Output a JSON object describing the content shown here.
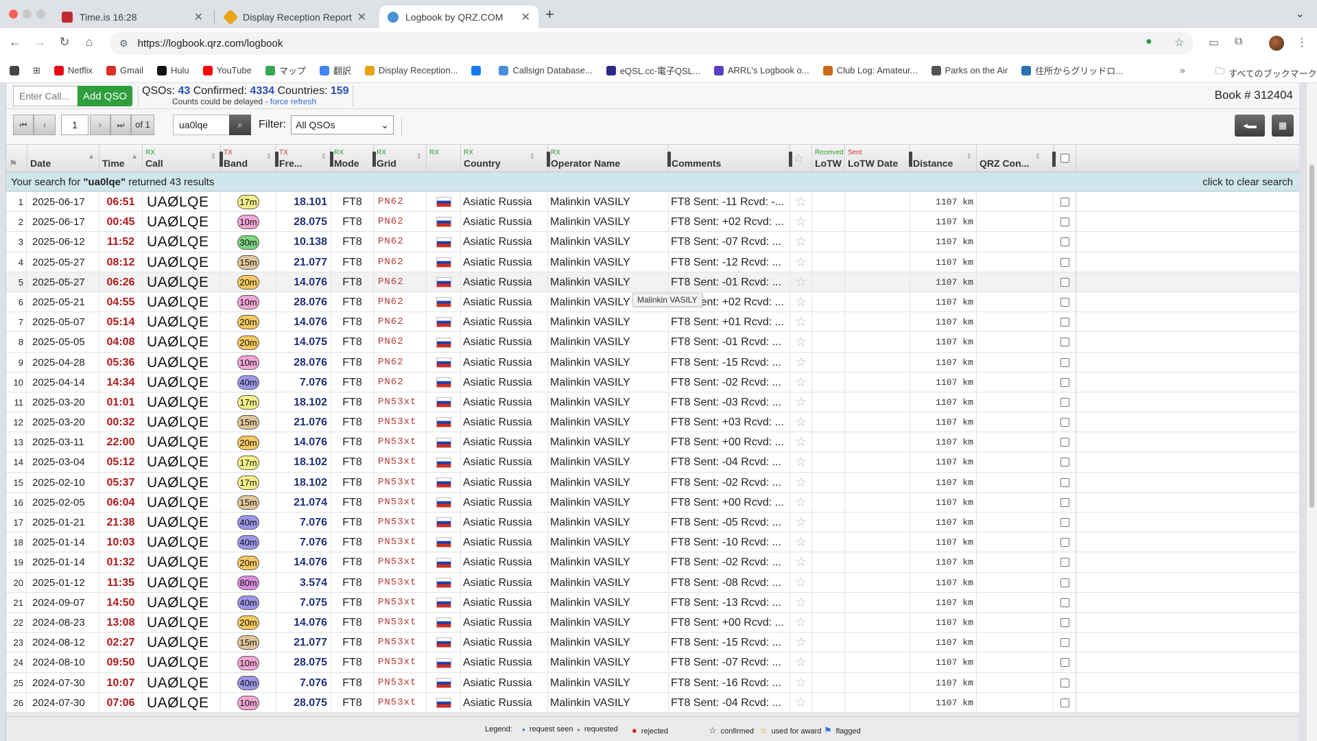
{
  "browser": {
    "tabs": [
      {
        "title": "Time.is 16:28",
        "favicon_color": "#c0282d",
        "active": false
      },
      {
        "title": "Display Reception Reports",
        "favicon_color": "#e8a317",
        "active": false
      },
      {
        "title": "Logbook by QRZ.COM",
        "favicon_color": "#4a90d9",
        "active": true
      }
    ],
    "url": "https://logbook.qrz.com/logbook",
    "bookmarks": [
      {
        "label": "Netflix",
        "color": "#e50914"
      },
      {
        "label": "Gmail",
        "color": "#d93025"
      },
      {
        "label": "Hulu",
        "color": "#111111"
      },
      {
        "label": "YouTube",
        "color": "#ff0000"
      },
      {
        "label": "マップ",
        "color": "#34a853"
      },
      {
        "label": "翻訳",
        "color": "#4285f4"
      },
      {
        "label": "Display Reception...",
        "color": "#e8a317"
      },
      {
        "label": "",
        "color": "#1877f2"
      },
      {
        "label": "Callsign Database...",
        "color": "#4a90d9"
      },
      {
        "label": "eQSL.cc-電子QSL...",
        "color": "#2b2b8a"
      },
      {
        "label": "ARRL's Logbook o...",
        "color": "#5a3fc0"
      },
      {
        "label": "Club Log: Amateur...",
        "color": "#c96a1a"
      },
      {
        "label": "Parks on the Air",
        "color": "#555555"
      },
      {
        "label": "住所からグリッドロ...",
        "color": "#2a6fb0"
      }
    ],
    "all_bookmarks": "すべてのブックマーク"
  },
  "header": {
    "call_placeholder": "Enter Call...",
    "add_qso": "Add QSO",
    "qsos_label": "QSOs:",
    "qsos": "43",
    "confirmed_label": "Confirmed:",
    "confirmed": "4334",
    "countries_label": "Countries:",
    "countries": "159",
    "delay_note": "Counts could be delayed - ",
    "force_refresh": "force refresh",
    "book": "Book # 312404"
  },
  "pager": {
    "page": "1",
    "of": "of 1",
    "search_value": "ua0lqe",
    "filter_label": "Filter:",
    "filter_value": "All QSOs"
  },
  "columns": {
    "date": "Date",
    "time": "Time",
    "call_sub": "RX",
    "call": "Call",
    "band_sub": "TX",
    "band": "Band",
    "freq_sub": "TX",
    "freq": "Fre...",
    "mode_sub": "RX",
    "mode": "Mode",
    "grid_sub": "RX",
    "grid": "Grid",
    "flag_sub": "RX",
    "country_sub": "RX",
    "country": "Country",
    "op_sub": "RX",
    "op": "Operator Name",
    "comments": "Comments",
    "lotw_sub": "Received",
    "lotw": "LoTW",
    "lotwd_sub": "Sent",
    "lotwd": "LoTW Date",
    "distance": "Distance",
    "qrz": "QRZ Con..."
  },
  "banner": {
    "prefix": "Your search for ",
    "term": "\"ua0lqe\"",
    "suffix": " returned 43 results",
    "clear": "click to clear search"
  },
  "band_colors": {
    "17m": "#f4ef8a",
    "10m": "#f2a6d6",
    "30m": "#7fd67f",
    "15m": "#e0c69a",
    "20m": "#f6c861",
    "40m": "#9d96e8",
    "80m": "#d88fe0"
  },
  "rows": [
    {
      "n": "1",
      "date": "2025-06-17",
      "time": "06:51",
      "call": "UAØLQE",
      "band": "17m",
      "freq": "18.101",
      "mode": "FT8",
      "grid": "PN62",
      "country": "Asiatic Russia",
      "op": "Malinkin VASILY",
      "comment": "FT8 Sent: -11 Rcvd: -...",
      "dist": "1107",
      "unit": "km"
    },
    {
      "n": "2",
      "date": "2025-06-17",
      "time": "00:45",
      "call": "UAØLQE",
      "band": "10m",
      "freq": "28.075",
      "mode": "FT8",
      "grid": "PN62",
      "country": "Asiatic Russia",
      "op": "Malinkin VASILY",
      "comment": "FT8 Sent: +02 Rcvd: ...",
      "dist": "1107",
      "unit": "km"
    },
    {
      "n": "3",
      "date": "2025-06-12",
      "time": "11:52",
      "call": "UAØLQE",
      "band": "30m",
      "freq": "10.138",
      "mode": "FT8",
      "grid": "PN62",
      "country": "Asiatic Russia",
      "op": "Malinkin VASILY",
      "comment": "FT8 Sent: -07 Rcvd: ...",
      "dist": "1107",
      "unit": "km"
    },
    {
      "n": "4",
      "date": "2025-05-27",
      "time": "08:12",
      "call": "UAØLQE",
      "band": "15m",
      "freq": "21.077",
      "mode": "FT8",
      "grid": "PN62",
      "country": "Asiatic Russia",
      "op": "Malinkin VASILY",
      "comment": "FT8 Sent: -12 Rcvd: ...",
      "dist": "1107",
      "unit": "km"
    },
    {
      "n": "5",
      "date": "2025-05-27",
      "time": "06:26",
      "call": "UAØLQE",
      "band": "20m",
      "freq": "14.076",
      "mode": "FT8",
      "grid": "PN62",
      "country": "Asiatic Russia",
      "op": "Malinkin VASILY",
      "comment": "FT8 Sent: -01 Rcvd: ...",
      "dist": "1107",
      "unit": "km"
    },
    {
      "n": "6",
      "date": "2025-05-21",
      "time": "04:55",
      "call": "UAØLQE",
      "band": "10m",
      "freq": "28.076",
      "mode": "FT8",
      "grid": "PN62",
      "country": "Asiatic Russia",
      "op": "Malinkin VASILY",
      "comment": "FT8 Sent: +02 Rcvd: ...",
      "dist": "1107",
      "unit": "km"
    },
    {
      "n": "7",
      "date": "2025-05-07",
      "time": "05:14",
      "call": "UAØLQE",
      "band": "20m",
      "freq": "14.076",
      "mode": "FT8",
      "grid": "PN62",
      "country": "Asiatic Russia",
      "op": "Malinkin VASILY",
      "comment": "FT8 Sent: +01 Rcvd: ...",
      "dist": "1107",
      "unit": "km"
    },
    {
      "n": "8",
      "date": "2025-05-05",
      "time": "04:08",
      "call": "UAØLQE",
      "band": "20m",
      "freq": "14.075",
      "mode": "FT8",
      "grid": "PN62",
      "country": "Asiatic Russia",
      "op": "Malinkin VASILY",
      "comment": "FT8 Sent: -01 Rcvd: ...",
      "dist": "1107",
      "unit": "km"
    },
    {
      "n": "9",
      "date": "2025-04-28",
      "time": "05:36",
      "call": "UAØLQE",
      "band": "10m",
      "freq": "28.076",
      "mode": "FT8",
      "grid": "PN62",
      "country": "Asiatic Russia",
      "op": "Malinkin VASILY",
      "comment": "FT8 Sent: -15 Rcvd: ...",
      "dist": "1107",
      "unit": "km"
    },
    {
      "n": "10",
      "date": "2025-04-14",
      "time": "14:34",
      "call": "UAØLQE",
      "band": "40m",
      "freq": "7.076",
      "mode": "FT8",
      "grid": "PN62",
      "country": "Asiatic Russia",
      "op": "Malinkin VASILY",
      "comment": "FT8 Sent: -02 Rcvd: ...",
      "dist": "1107",
      "unit": "km"
    },
    {
      "n": "11",
      "date": "2025-03-20",
      "time": "01:01",
      "call": "UAØLQE",
      "band": "17m",
      "freq": "18.102",
      "mode": "FT8",
      "grid": "PN53xt",
      "country": "Asiatic Russia",
      "op": "Malinkin VASILY",
      "comment": "FT8 Sent: -03 Rcvd: ...",
      "dist": "1107",
      "unit": "km"
    },
    {
      "n": "12",
      "date": "2025-03-20",
      "time": "00:32",
      "call": "UAØLQE",
      "band": "15m",
      "freq": "21.076",
      "mode": "FT8",
      "grid": "PN53xt",
      "country": "Asiatic Russia",
      "op": "Malinkin VASILY",
      "comment": "FT8 Sent: +03 Rcvd: ...",
      "dist": "1107",
      "unit": "km"
    },
    {
      "n": "13",
      "date": "2025-03-11",
      "time": "22:00",
      "call": "UAØLQE",
      "band": "20m",
      "freq": "14.076",
      "mode": "FT8",
      "grid": "PN53xt",
      "country": "Asiatic Russia",
      "op": "Malinkin VASILY",
      "comment": "FT8 Sent: +00 Rcvd: ...",
      "dist": "1107",
      "unit": "km"
    },
    {
      "n": "14",
      "date": "2025-03-04",
      "time": "05:12",
      "call": "UAØLQE",
      "band": "17m",
      "freq": "18.102",
      "mode": "FT8",
      "grid": "PN53xt",
      "country": "Asiatic Russia",
      "op": "Malinkin VASILY",
      "comment": "FT8 Sent: -04 Rcvd: ...",
      "dist": "1107",
      "unit": "km"
    },
    {
      "n": "15",
      "date": "2025-02-10",
      "time": "05:37",
      "call": "UAØLQE",
      "band": "17m",
      "freq": "18.102",
      "mode": "FT8",
      "grid": "PN53xt",
      "country": "Asiatic Russia",
      "op": "Malinkin VASILY",
      "comment": "FT8 Sent: -02 Rcvd: ...",
      "dist": "1107",
      "unit": "km"
    },
    {
      "n": "16",
      "date": "2025-02-05",
      "time": "06:04",
      "call": "UAØLQE",
      "band": "15m",
      "freq": "21.074",
      "mode": "FT8",
      "grid": "PN53xt",
      "country": "Asiatic Russia",
      "op": "Malinkin VASILY",
      "comment": "FT8 Sent: +00 Rcvd: ...",
      "dist": "1107",
      "unit": "km"
    },
    {
      "n": "17",
      "date": "2025-01-21",
      "time": "21:38",
      "call": "UAØLQE",
      "band": "40m",
      "freq": "7.076",
      "mode": "FT8",
      "grid": "PN53xt",
      "country": "Asiatic Russia",
      "op": "Malinkin VASILY",
      "comment": "FT8 Sent: -05 Rcvd: ...",
      "dist": "1107",
      "unit": "km"
    },
    {
      "n": "18",
      "date": "2025-01-14",
      "time": "10:03",
      "call": "UAØLQE",
      "band": "40m",
      "freq": "7.076",
      "mode": "FT8",
      "grid": "PN53xt",
      "country": "Asiatic Russia",
      "op": "Malinkin VASILY",
      "comment": "FT8 Sent: -10 Rcvd: ...",
      "dist": "1107",
      "unit": "km"
    },
    {
      "n": "19",
      "date": "2025-01-14",
      "time": "01:32",
      "call": "UAØLQE",
      "band": "20m",
      "freq": "14.076",
      "mode": "FT8",
      "grid": "PN53xt",
      "country": "Asiatic Russia",
      "op": "Malinkin VASILY",
      "comment": "FT8 Sent: -02 Rcvd: ...",
      "dist": "1107",
      "unit": "km"
    },
    {
      "n": "20",
      "date": "2025-01-12",
      "time": "11:35",
      "call": "UAØLQE",
      "band": "80m",
      "freq": "3.574",
      "mode": "FT8",
      "grid": "PN53xt",
      "country": "Asiatic Russia",
      "op": "Malinkin VASILY",
      "comment": "FT8 Sent: -08 Rcvd: ...",
      "dist": "1107",
      "unit": "km"
    },
    {
      "n": "21",
      "date": "2024-09-07",
      "time": "14:50",
      "call": "UAØLQE",
      "band": "40m",
      "freq": "7.075",
      "mode": "FT8",
      "grid": "PN53xt",
      "country": "Asiatic Russia",
      "op": "Malinkin VASILY",
      "comment": "FT8 Sent: -13 Rcvd: ...",
      "dist": "1107",
      "unit": "km"
    },
    {
      "n": "22",
      "date": "2024-08-23",
      "time": "13:08",
      "call": "UAØLQE",
      "band": "20m",
      "freq": "14.076",
      "mode": "FT8",
      "grid": "PN53xt",
      "country": "Asiatic Russia",
      "op": "Malinkin VASILY",
      "comment": "FT8 Sent: +00 Rcvd: ...",
      "dist": "1107",
      "unit": "km"
    },
    {
      "n": "23",
      "date": "2024-08-12",
      "time": "02:27",
      "call": "UAØLQE",
      "band": "15m",
      "freq": "21.077",
      "mode": "FT8",
      "grid": "PN53xt",
      "country": "Asiatic Russia",
      "op": "Malinkin VASILY",
      "comment": "FT8 Sent: -15 Rcvd: ...",
      "dist": "1107",
      "unit": "km"
    },
    {
      "n": "24",
      "date": "2024-08-10",
      "time": "09:50",
      "call": "UAØLQE",
      "band": "10m",
      "freq": "28.075",
      "mode": "FT8",
      "grid": "PN53xt",
      "country": "Asiatic Russia",
      "op": "Malinkin VASILY",
      "comment": "FT8 Sent: -07 Rcvd: ...",
      "dist": "1107",
      "unit": "km"
    },
    {
      "n": "25",
      "date": "2024-07-30",
      "time": "10:07",
      "call": "UAØLQE",
      "band": "40m",
      "freq": "7.076",
      "mode": "FT8",
      "grid": "PN53xt",
      "country": "Asiatic Russia",
      "op": "Malinkin VASILY",
      "comment": "FT8 Sent: -16 Rcvd: ...",
      "dist": "1107",
      "unit": "km"
    },
    {
      "n": "26",
      "date": "2024-07-30",
      "time": "07:06",
      "call": "UAØLQE",
      "band": "10m",
      "freq": "28.075",
      "mode": "FT8",
      "grid": "PN53xt",
      "country": "Asiatic Russia",
      "op": "Malinkin VASILY",
      "comment": "FT8 Sent: -04 Rcvd: ...",
      "dist": "1107",
      "unit": "km"
    }
  ],
  "tooltip": "Malinkin VASILY",
  "legend": {
    "title": "Legend:",
    "items": [
      {
        "label": "request seen",
        "icon": "blue-dot-icon",
        "color": "#2a6fd8"
      },
      {
        "label": "requested",
        "icon": "gray-dot-icon",
        "color": "#888888"
      },
      {
        "label": "rejected",
        "icon": "rejected-icon",
        "color": "#d32020"
      },
      {
        "label": "confirmed",
        "icon": "star-outline-icon",
        "color": "#333333"
      },
      {
        "label": "used for award",
        "icon": "star-award-icon",
        "color": "#c9a000"
      },
      {
        "label": "flagged",
        "icon": "flag-icon",
        "color": "#2a6fd8"
      }
    ]
  }
}
